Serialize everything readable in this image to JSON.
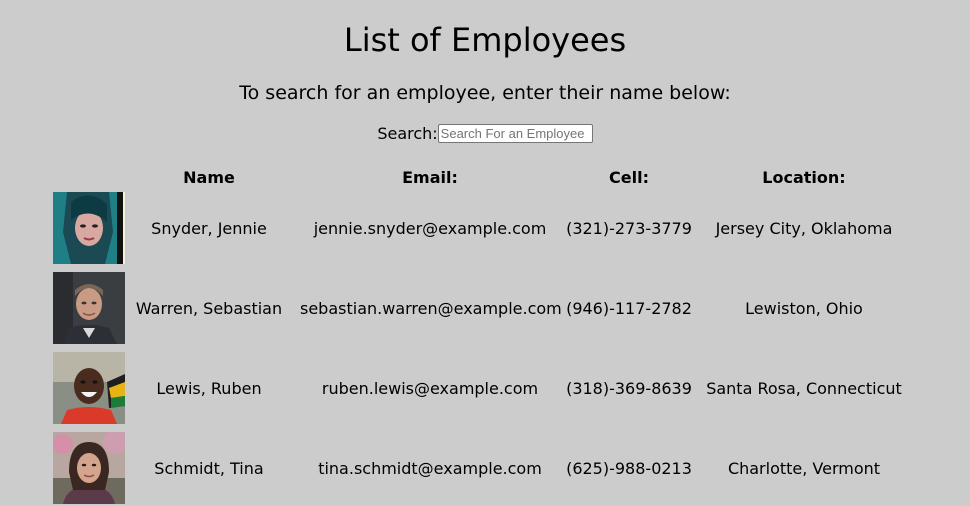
{
  "title": "List of Employees",
  "subtitle": "To search for an employee, enter their name below:",
  "search": {
    "label": "Search:",
    "placeholder": "Search For an Employee",
    "value": ""
  },
  "table": {
    "headers": {
      "name": "Name",
      "email": "Email:",
      "cell": "Cell:",
      "location": "Location:"
    },
    "rows": [
      {
        "name": "Snyder, Jennie",
        "email": "jennie.snyder@example.com",
        "cell": "(321)-273-3779",
        "location": "Jersey City, Oklahoma"
      },
      {
        "name": "Warren, Sebastian",
        "email": "sebastian.warren@example.com",
        "cell": "(946)-117-2782",
        "location": "Lewiston, Ohio"
      },
      {
        "name": "Lewis, Ruben",
        "email": "ruben.lewis@example.com",
        "cell": "(318)-369-8639",
        "location": "Santa Rosa, Connecticut"
      },
      {
        "name": "Schmidt, Tina",
        "email": "tina.schmidt@example.com",
        "cell": "(625)-988-0213",
        "location": "Charlotte, Vermont"
      }
    ]
  }
}
